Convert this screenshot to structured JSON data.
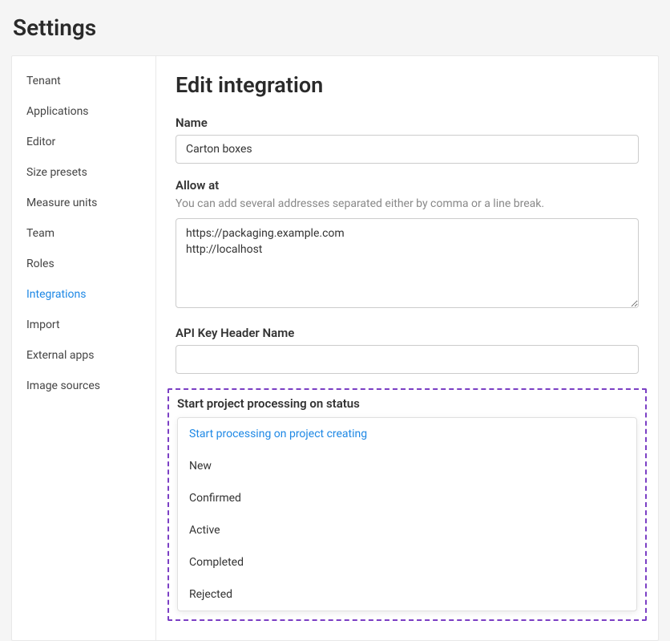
{
  "page_title": "Settings",
  "sidebar": {
    "items": [
      {
        "label": "Tenant",
        "active": false
      },
      {
        "label": "Applications",
        "active": false
      },
      {
        "label": "Editor",
        "active": false
      },
      {
        "label": "Size presets",
        "active": false
      },
      {
        "label": "Measure units",
        "active": false
      },
      {
        "label": "Team",
        "active": false
      },
      {
        "label": "Roles",
        "active": false
      },
      {
        "label": "Integrations",
        "active": true
      },
      {
        "label": "Import",
        "active": false
      },
      {
        "label": "External apps",
        "active": false
      },
      {
        "label": "Image sources",
        "active": false
      }
    ]
  },
  "main": {
    "heading": "Edit integration",
    "name": {
      "label": "Name",
      "value": "Carton boxes"
    },
    "allow_at": {
      "label": "Allow at",
      "hint": "You can add several addresses separated either by comma or a line break.",
      "value": "https://packaging.example.com\nhttp://localhost"
    },
    "api_key_header": {
      "label": "API Key Header Name",
      "value": ""
    },
    "start_project": {
      "label": "Start project processing on status",
      "options": [
        {
          "label": "Start processing on project creating",
          "selected": true
        },
        {
          "label": "New",
          "selected": false
        },
        {
          "label": "Confirmed",
          "selected": false
        },
        {
          "label": "Active",
          "selected": false
        },
        {
          "label": "Completed",
          "selected": false
        },
        {
          "label": "Rejected",
          "selected": false
        }
      ]
    }
  }
}
